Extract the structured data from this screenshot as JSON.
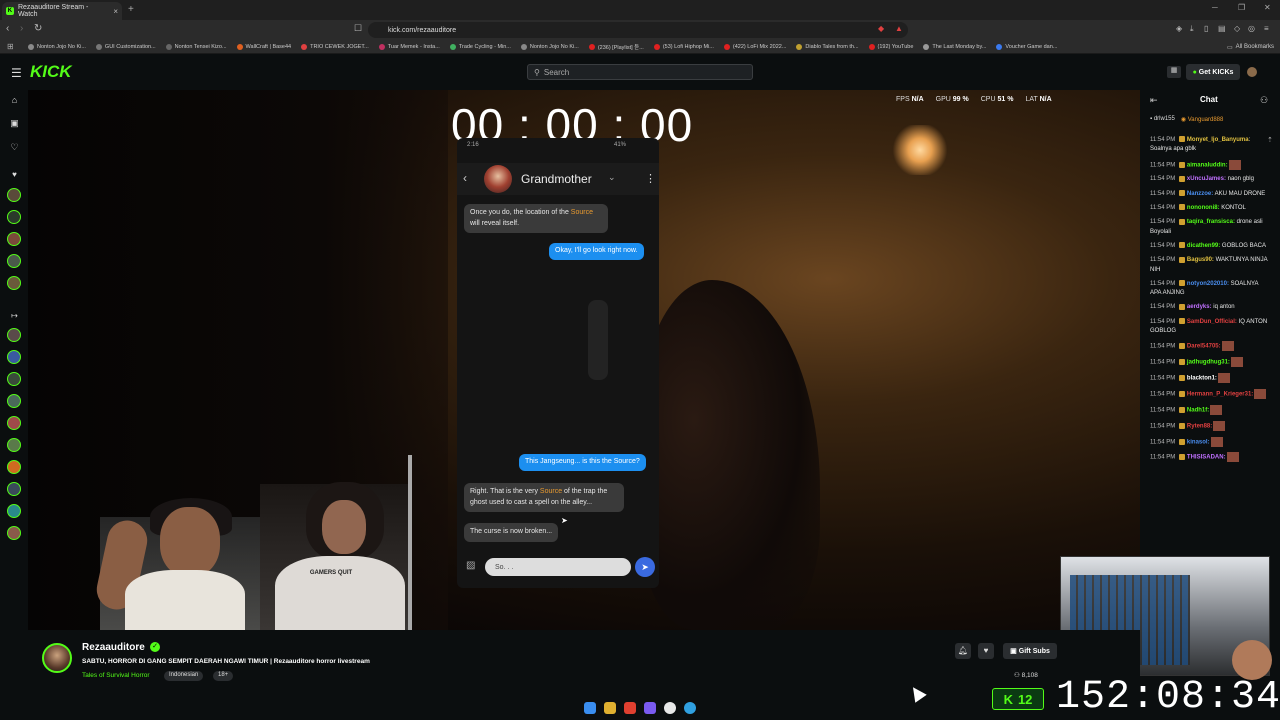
{
  "browser": {
    "tab_title": "Rezaauditore Stream - Watch",
    "tab_close": "×",
    "new_tab": "+",
    "url": "kick.com/rezaauditore",
    "window_controls": [
      "─",
      "❐",
      "✕"
    ],
    "bookmarks": [
      "Nonton Jojo No Ki...",
      "GUI Customization...",
      "Nonton Tensei Kizo...",
      "WallCraft | Base44",
      "TRIO CEWEK JOGET...",
      "Tuar Memek - Insta...",
      "Trade Cycling - Min...",
      "Nonton Jojo No Ki...",
      "(236) [Playlist] 듣...",
      "(53) Lofi Hiphop Mi...",
      "(422) LoFi Mix 2022...",
      "Diablo Tales from th...",
      "(192) YouTube",
      "The Last Monday by...",
      "Voucher Game dan..."
    ],
    "all_bookmarks": "All Bookmarks"
  },
  "header": {
    "logo": "KICK",
    "search_placeholder": "Search",
    "get_kicks": "Get KICKs"
  },
  "video": {
    "timer": "00 : 00 : 00",
    "perf": [
      {
        "label": "FPS",
        "value": "N/A"
      },
      {
        "label": "GPU",
        "value": "99 %"
      },
      {
        "label": "CPU",
        "value": "51 %"
      },
      {
        "label": "LAT",
        "value": "N/A"
      }
    ],
    "phone": {
      "status_time": "2:16",
      "status_right": "41%",
      "contact": "Grandmother",
      "input_placeholder": "So. . .",
      "messages": [
        {
          "dir": "in",
          "pre": "Once you do, the location of the ",
          "hl": "Source",
          "post": " will reveal itself."
        },
        {
          "dir": "out",
          "text": "Okay, I'll go look right now."
        },
        {
          "dir": "out",
          "text": "This Jangseung... is this the Source?"
        },
        {
          "dir": "in",
          "pre": "Right. That is the very ",
          "hl": "Source",
          "post": " of the trap the ghost used to cast a spell on the alley..."
        },
        {
          "dir": "in",
          "pre": "The curse is now broken...",
          "hl": "",
          "post": ""
        }
      ]
    },
    "webcam_shirt": "GAMERS QUIT"
  },
  "chat": {
    "title": "Chat",
    "top_users": [
      "drlw155",
      "Vanguard888"
    ],
    "messages": [
      {
        "time": "11:54 PM",
        "user": "Monyet_Ijo_Banyuma",
        "color": "#e0c040",
        "text": ": Soalnya apa gblk"
      },
      {
        "time": "11:54 PM",
        "user": "aimanaluddin:",
        "color": "#53fc18",
        "text": ""
      },
      {
        "time": "11:54 PM",
        "user": "xUncuJames:",
        "color": "#c070ff",
        "text": " naon gblg"
      },
      {
        "time": "11:54 PM",
        "user": "Nanzzoe:",
        "color": "#4a8ef0",
        "text": " AKU MAU DRONE"
      },
      {
        "time": "11:54 PM",
        "user": "nonononi8:",
        "color": "#53fc18",
        "text": " KONTOL"
      },
      {
        "time": "11:54 PM",
        "user": "taqira_fransisca:",
        "color": "#53fc18",
        "text": " drone asli Boyolali"
      },
      {
        "time": "11:54 PM",
        "user": "dicathen99:",
        "color": "#53fc18",
        "text": " GOBLOG BACA"
      },
      {
        "time": "11:54 PM",
        "user": "Bagus90:",
        "color": "#e0c040",
        "text": " WAKTUNYA NINJA NIH"
      },
      {
        "time": "11:54 PM",
        "user": "notyon202010:",
        "color": "#4a8ef0",
        "text": " SOALNYA APA ANJING"
      },
      {
        "time": "11:54 PM",
        "user": "aerdyks:",
        "color": "#c070ff",
        "text": " iq anton"
      },
      {
        "time": "11:54 PM",
        "user": "SamDun_Official:",
        "color": "#e04040",
        "text": " IQ ANTON GOBLOG"
      },
      {
        "time": "11:54 PM",
        "user": "Darel54705:",
        "color": "#e04040",
        "text": ""
      },
      {
        "time": "11:54 PM",
        "user": "jadhugdhug31:",
        "color": "#53fc18",
        "text": ""
      },
      {
        "time": "11:54 PM",
        "user": "blackton1:",
        "color": "#ffffff",
        "text": ""
      },
      {
        "time": "11:54 PM",
        "user": "Hermann_P_Krieger31:",
        "color": "#e04040",
        "text": ""
      },
      {
        "time": "11:54 PM",
        "user": "Nadh1f:",
        "color": "#53fc18",
        "text": ""
      },
      {
        "time": "11:54 PM",
        "user": "Ryten88:",
        "color": "#e04040",
        "text": ""
      },
      {
        "time": "11:54 PM",
        "user": "kinasol:",
        "color": "#4a8ef0",
        "text": ""
      },
      {
        "time": "11:54 PM",
        "user": "THISISADAN:",
        "color": "#c070ff",
        "text": ""
      }
    ]
  },
  "stream": {
    "name": "Rezaauditore",
    "title": "SABTU, HORROR DI GANG SEMPIT DAERAH NGAWI TIMUR | Rezaauditore horror livestream",
    "category": "Tales of Survival Horror",
    "tags": [
      "Indonesian",
      "18+"
    ],
    "viewers": "8,108",
    "gift_subs": "Gift Subs",
    "kick_count": "12",
    "big_clock": "152:08:34"
  },
  "colors": {
    "accent": "#53fc18",
    "bubble_out": "#1c8ff0",
    "bubble_in": "#3a3a3a",
    "highlight": "#e89a30"
  }
}
